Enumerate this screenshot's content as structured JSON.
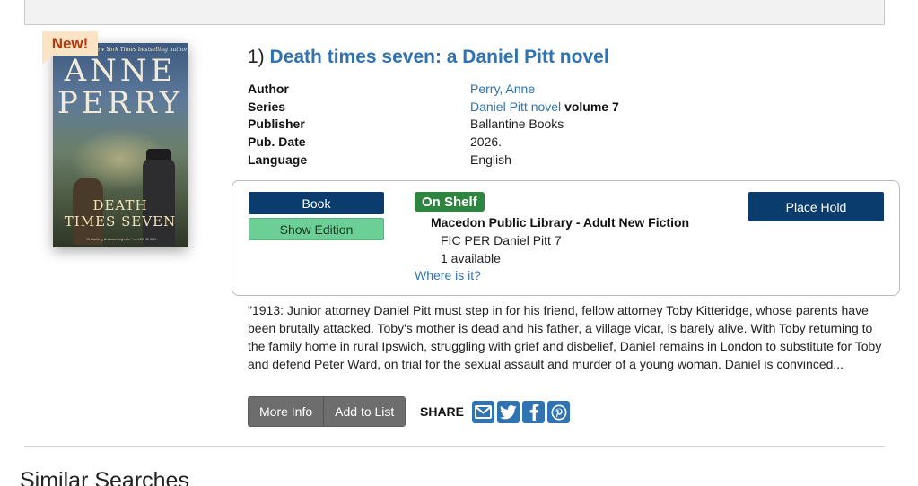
{
  "result": {
    "number": "1)",
    "title": "Death times seven: a Daniel Pitt novel",
    "badge": "New!",
    "cover": {
      "tagline": "#1 New York Times bestselling author",
      "author_first": "ANNE",
      "author_last": "PERRY",
      "title_line1": "DEATH",
      "title_line2": "TIMES SEVEN",
      "quote": "\"A startling & absorbing tale.\" — LEE CHILD"
    },
    "meta_labels": {
      "author": "Author",
      "series": "Series",
      "publisher": "Publisher",
      "pub_date": "Pub. Date",
      "language": "Language"
    },
    "meta_values": {
      "author": "Perry, Anne",
      "series": "Daniel Pitt novel",
      "series_volume": "volume 7",
      "publisher": "Ballantine Books",
      "pub_date": "2026.",
      "language": "English"
    }
  },
  "holdings": {
    "format_button": "Book",
    "edition_button": "Show Edition",
    "status": "On Shelf",
    "branch": "Macedon Public Library - Adult New Fiction",
    "call_number": "FIC PER Daniel Pitt 7",
    "availability": "1 available",
    "where_link": "Where is it?",
    "hold_button": "Place Hold"
  },
  "summary": "\"1913: Junior attorney Daniel Pitt must step in for his friend, fellow attorney Toby Kitteridge, whose parents have been brutally attacked. Toby's mother is dead and his father, a village vicar, is barely alive. With Toby returning to the family home in rural Ipswich, struggling with grief and disbelief, Daniel remains in London to substitute for Toby and defend Peter Ward, on trial for the sexual assault and murder of a young woman. Daniel is convinced...",
  "actions": {
    "more_info": "More Info",
    "add_to_list": "Add to List",
    "share_label": "SHARE",
    "share_icons": [
      "email-icon",
      "twitter-icon",
      "facebook-icon",
      "pinterest-icon"
    ]
  },
  "similar_heading": "Similar Searches",
  "colors": {
    "link": "#2f73b3",
    "primary_button": "#0b3c6e",
    "edition_button": "#6ccf96",
    "on_shelf": "#2e8540",
    "new_badge_bg": "#fbe3c5",
    "new_badge_text": "#b23a0e",
    "secondary_button": "#6d6d6d"
  }
}
